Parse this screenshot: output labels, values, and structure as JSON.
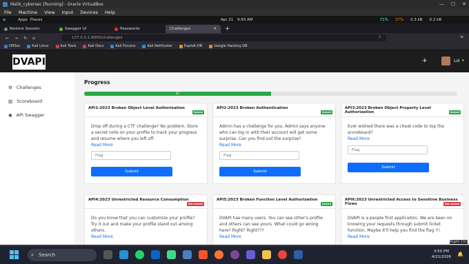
{
  "vbox": {
    "title": "Malik_cybersec [Running] - Oracle VirtualBox",
    "menu": [
      "File",
      "Machine",
      "View",
      "Input",
      "Devices",
      "Help"
    ]
  },
  "kali": {
    "apps": "Apps",
    "places": "Places",
    "date": "Apr 21",
    "time": "9:50 AM",
    "cpu": "71%",
    "mem": "37%",
    "net_up": "0.3 kB",
    "net_down": "0.2 kB"
  },
  "tabs": [
    {
      "label": "Restore Session",
      "color": "#888"
    },
    {
      "label": "Swagger UI",
      "color": "#6db33f"
    },
    {
      "label": "Passwords",
      "color": "#e3342f"
    },
    {
      "label": "Challenges",
      "color": "#888"
    }
  ],
  "url": "127.0.0.1:8000/challenges",
  "bookmarks": [
    {
      "label": "OffSec",
      "color": "#3a7bd5"
    },
    {
      "label": "Kali Linux",
      "color": "#2a8fd5"
    },
    {
      "label": "Kali Tools",
      "color": "#d53a3a"
    },
    {
      "label": "Kali Docs",
      "color": "#d53a3a"
    },
    {
      "label": "Kali Forums",
      "color": "#2a8fd5"
    },
    {
      "label": "Kali NetHunter",
      "color": "#2a8fd5"
    },
    {
      "label": "Exploit-DB",
      "color": "#e08a2a"
    },
    {
      "label": "Google Hacking DB",
      "color": "#e08a2a"
    }
  ],
  "app": {
    "logo": "DVAPI",
    "user": "Lol"
  },
  "sidebar": [
    {
      "label": "Challenges",
      "icon": "gear-icon"
    },
    {
      "label": "Scoreboard",
      "icon": "chart-icon"
    },
    {
      "label": "API Swagger",
      "icon": "api-icon"
    }
  ],
  "progress": {
    "title": "Progress",
    "value": 50,
    "label": "50"
  },
  "colors": {
    "solved": "#28a745",
    "unsolved": "#dc3545",
    "accent": "#0d6efd"
  },
  "cards": [
    {
      "title": "API1:2023 Broken Object Level Authorization",
      "status": "Solved",
      "desc": "Drop off during a CTF challenge? No problem. Store a secret note on your profile to track your progress and resume where you left off.",
      "more": "Read More",
      "placeholder": "Flag",
      "submit": "Submit"
    },
    {
      "title": "API2:2023 Broken Authentication",
      "status": "Solved",
      "desc": "Admin has a challenge for you. Admin says anyone who can log in with their account will get some surprise. Can you find out the surprise?",
      "more": "Read More",
      "placeholder": "Flag",
      "submit": "Submit"
    },
    {
      "title": "API3:2023 Broken Object Property Level Authorization",
      "status": "Solved",
      "desc": "Ever wished there was a cheat code to top the scoreboard?",
      "more": "Read More",
      "placeholder": "Flag",
      "submit": "Submit"
    },
    {
      "title": "API4:2023 Unrestricted Resource Consumption",
      "status": "Not solved",
      "desc": "Do you know that you can customize your profile? Try it out and make your profile stand out among others.",
      "more": "Read More"
    },
    {
      "title": "API5:2023 Broken Function Level Authorization",
      "status": "Solved",
      "desc": "DVAPI has many users. You can see other's profile and others can see yours. What could go wrong here? Right? Right???",
      "more": "Read More"
    },
    {
      "title": "API6:2023 Unrestricted Access to Sensitive Business Flows",
      "status": "Not solved",
      "desc": "DVAPI is a people first applicaiton. We are keen on knowing your requests through submit ticket function. Maybe it'll help you find the flag !!!",
      "more": "Read More"
    }
  ],
  "taskbar": {
    "search": "Search",
    "time": "3:50 PM",
    "date": "4/21/2026",
    "right_ctrl": "Right Ctrl"
  }
}
